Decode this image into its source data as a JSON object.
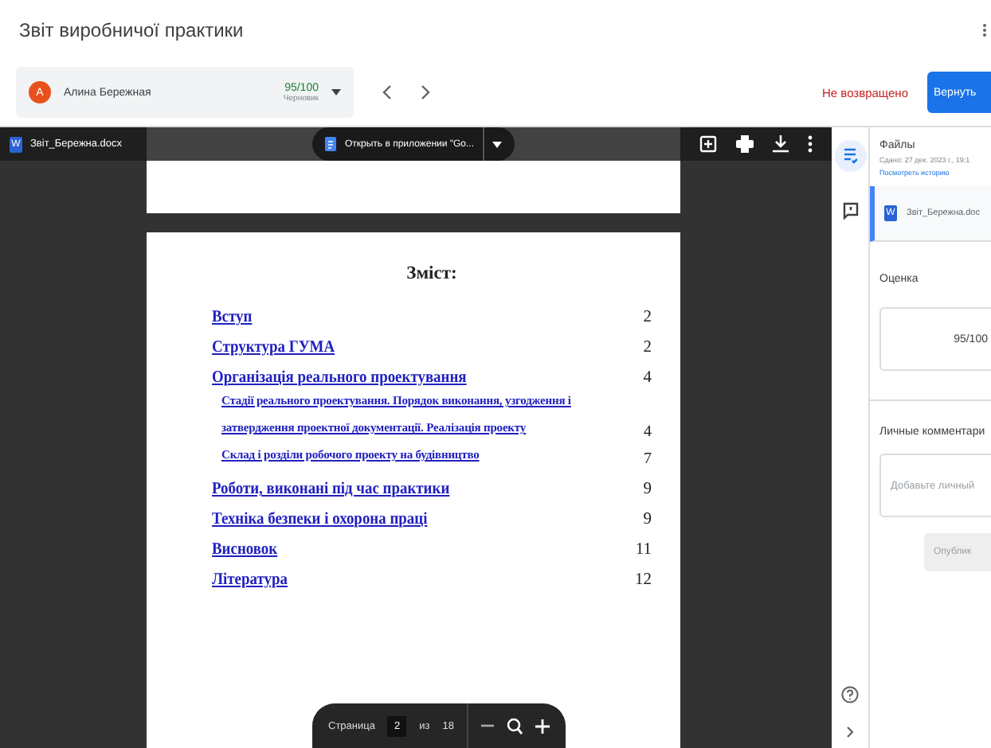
{
  "header": {
    "title": "Звіт виробничої практики"
  },
  "student": {
    "initial": "А",
    "name": "Алина Бережная",
    "grade": "95/100",
    "status": "Черновик"
  },
  "return_status": "Не возвращено",
  "return_button": "Вернуть",
  "viewer": {
    "file_icon": "W",
    "file_name": "Звіт_Бережна.docx",
    "open_button": "Открыть в приложении \"Go...",
    "toc_title": "Зміст:",
    "toc": [
      {
        "title": "Вступ",
        "page": "2"
      },
      {
        "title": "Структура ГУМА",
        "page": "2"
      },
      {
        "title": "Організація реального проектування",
        "page": "4",
        "children": [
          {
            "title": "Стадії реального проектування. Порядок виконання, узгодження і затвердження проектної документації. Реалізація проекту",
            "page": "4"
          },
          {
            "title": "Склад і розділи робочого проекту на будівництво",
            "page": "7"
          }
        ]
      },
      {
        "title": "Роботи, виконані під час практики",
        "page": "9"
      },
      {
        "title": "Техніка безпеки і охорона праці",
        "page": "9"
      },
      {
        "title": "Висновок",
        "page": "11"
      },
      {
        "title": "Література",
        "page": "12"
      }
    ]
  },
  "pager": {
    "label": "Страница",
    "page": "2",
    "of": "из",
    "total": "18"
  },
  "rail": [
    {
      "kind": "files",
      "selected": true
    },
    {
      "kind": "comment",
      "selected": false
    }
  ],
  "panel": {
    "files_title": "Файлы",
    "submitted": "Сдано: 27 дек. 2023 г., 19:1",
    "history_link": "Посмотреть историю",
    "attachment_icon": "W",
    "attachment": "Звіт_Бережна.doc",
    "grade_title": "Оценка",
    "grade": "95/100",
    "comments_title": "Личные комментари",
    "comment_placeholder": "Добавьте личный",
    "post_button": {
      "label": "Опублик",
      "disabled": true
    }
  }
}
